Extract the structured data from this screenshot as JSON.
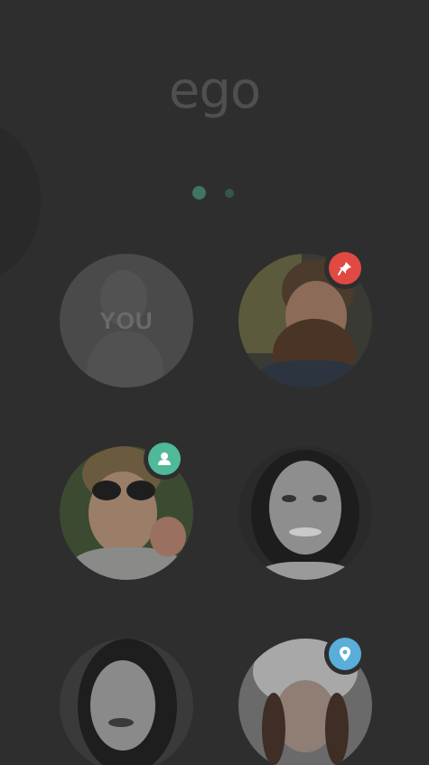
{
  "app": {
    "logo_text": "ego"
  },
  "pager": {
    "pages": 2,
    "active_index": 0
  },
  "grid": {
    "self": {
      "label": "YOU"
    },
    "contacts": [
      {
        "badge": "pin-icon",
        "badge_color": "#e04a42"
      },
      {
        "badge": "person-icon",
        "badge_color": "#4fb99a"
      },
      {
        "badge": null
      },
      {
        "badge": null
      },
      {
        "badge": "location-icon",
        "badge_color": "#5aaed9"
      }
    ]
  },
  "colors": {
    "background": "#2e2e2e",
    "accent_green": "#3f7565",
    "logo": "#4f4f4f"
  }
}
